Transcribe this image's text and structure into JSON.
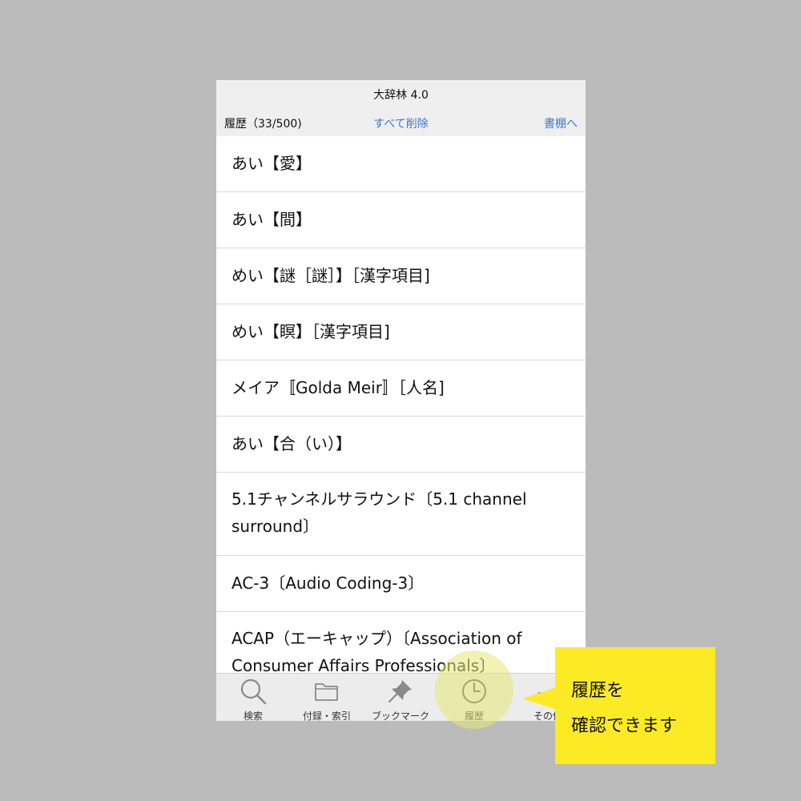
{
  "navbar": {
    "title": "大辞林 4.0",
    "history_count": "履歴（33/500)",
    "clear_all": "すべて削除",
    "to_bookshelf": "書棚へ"
  },
  "history_items": [
    {
      "label": "あい【愛】"
    },
    {
      "label": "あい【間】"
    },
    {
      "label": "めい【謎［謎］】［漢字項目]"
    },
    {
      "label": "めい【瞑】［漢字項目]"
    },
    {
      "label": "メイア〚Golda Meir〛［人名]"
    },
    {
      "label": "あい【合（い）】"
    },
    {
      "label": "5.1チャンネルサラウンド〔5.1 channel surround〕"
    },
    {
      "label": "AC-3〔Audio Coding-3〕"
    },
    {
      "label": "ACAP（エーキャップ）〔Association of Consumer Affairs Professionals〕"
    }
  ],
  "tabbar": {
    "tabs": [
      {
        "label": "検索",
        "icon": "magnifier-icon"
      },
      {
        "label": "付録・索引",
        "icon": "folder-icon"
      },
      {
        "label": "ブックマーク",
        "icon": "pushpin-icon"
      },
      {
        "label": "履歴",
        "icon": "clock-icon"
      },
      {
        "label": "その他",
        "icon": "more-icon"
      }
    ]
  },
  "callout": {
    "line1": "履歴を",
    "line2": "確認できます"
  },
  "colors": {
    "background": "#bbbbbb",
    "accent_link": "#3a78c9",
    "callout": "#fceb24",
    "highlight": "#e8e878"
  }
}
